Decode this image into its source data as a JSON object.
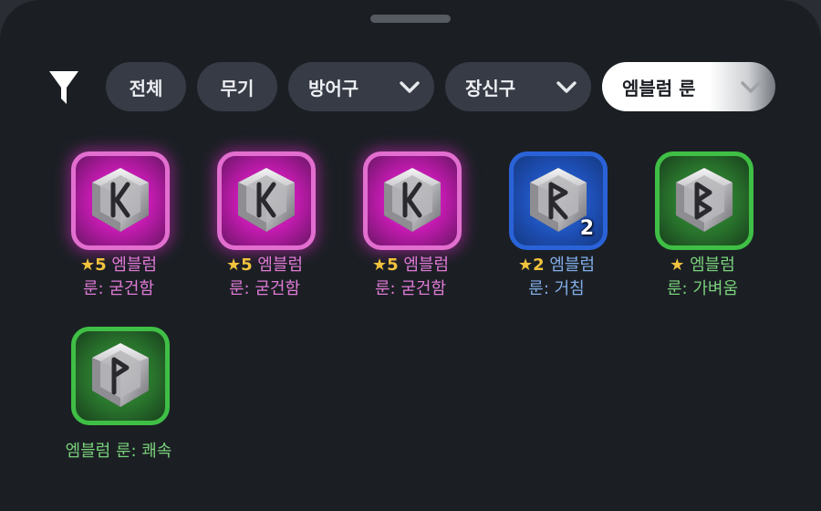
{
  "filters": {
    "all_label": "전체",
    "weapon_label": "무기",
    "armor_label": "방어구",
    "accessory_label": "장신구",
    "emblem_rune_label": "엠블럼 룬"
  },
  "items": [
    {
      "stars": "★5",
      "name_line1": "엠블럼",
      "name_line2": "룬: 굳건함",
      "grade": "epic",
      "rune_icon": "kaunan-rune-icon"
    },
    {
      "stars": "★5",
      "name_line1": "엠블럼",
      "name_line2": "룬: 굳건함",
      "grade": "epic",
      "rune_icon": "kaunan-rune-icon"
    },
    {
      "stars": "★5",
      "name_line1": "엠블럼",
      "name_line2": "룬: 굳건함",
      "grade": "epic",
      "rune_icon": "kaunan-rune-icon"
    },
    {
      "stars": "★2",
      "name_line1": "엠블럼",
      "name_line2": "룬: 거침",
      "grade": "rare",
      "rune_icon": "raido-rune-icon",
      "count": "2"
    },
    {
      "stars": "★",
      "name_line1": "엠블럼",
      "name_line2": "룬: 가벼움",
      "grade": "uncommon",
      "rune_icon": "berkana-rune-icon"
    },
    {
      "name_full": "엠블럼 룬: 쾌속",
      "grade": "uncommon",
      "rune_icon": "wunjo-rune-icon"
    }
  ],
  "colors": {
    "epic": "#e07ad6",
    "rare": "#82aee8",
    "uncommon": "#7ad17b",
    "star": "#f2c23e",
    "background": "#1b1f24",
    "chip": "#363b45"
  }
}
